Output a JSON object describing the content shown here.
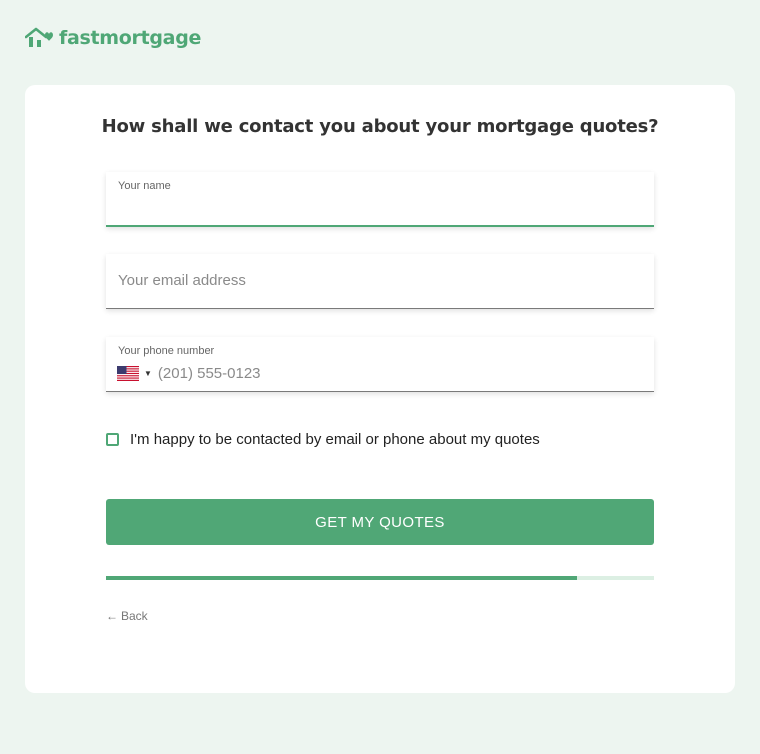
{
  "brand": {
    "name": "fastmortgage",
    "color": "#4fa776"
  },
  "form": {
    "heading": "How shall we contact you about your mortgage quotes?",
    "name_field": {
      "label": "Your name",
      "value": ""
    },
    "email_field": {
      "placeholder": "Your email address",
      "value": ""
    },
    "phone_field": {
      "label": "Your phone number",
      "country": "US",
      "flag_icon": "us-flag-icon",
      "placeholder": "(201) 555-0123",
      "value": ""
    },
    "consent": {
      "label": "I'm happy to be contacted by email or phone about my quotes",
      "checked": false
    },
    "submit_label": "GET MY QUOTES",
    "progress": 0.86,
    "back_label": "Back",
    "back_icon": "arrow-left-icon"
  }
}
